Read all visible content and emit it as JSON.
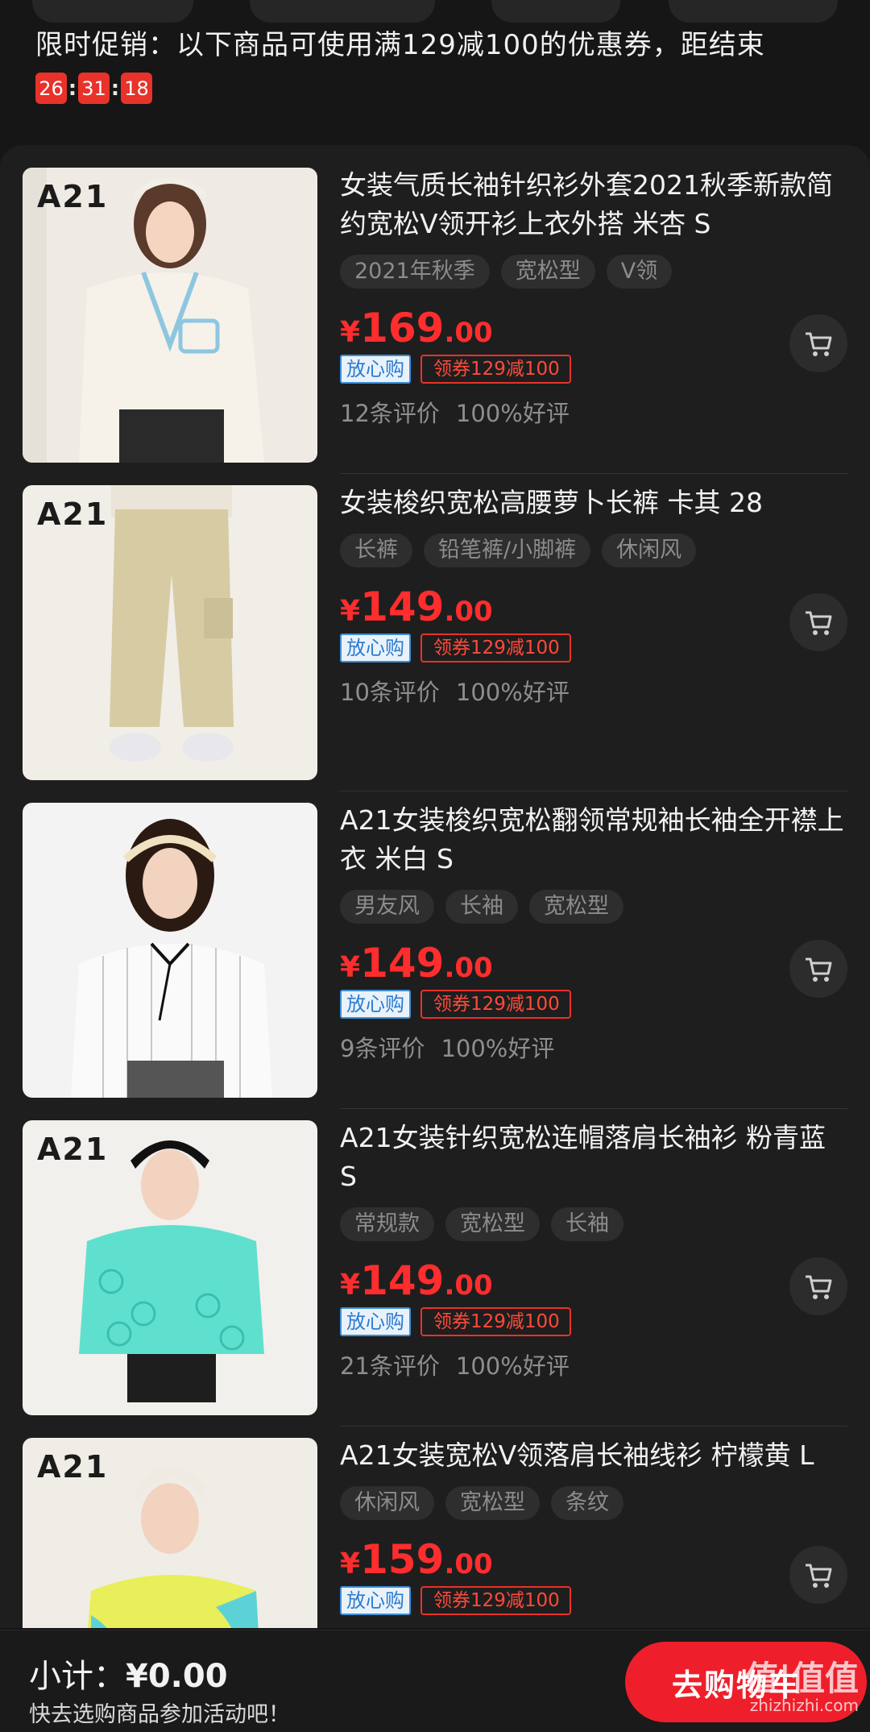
{
  "promo": {
    "text": "限时促销：以下商品可使用满129减100的优惠券，距结束",
    "countdown": {
      "hours": "26",
      "minutes": "31",
      "seconds": "18",
      "sep": ":"
    }
  },
  "products": [
    {
      "title": "女装气质长袖针织衫外套2021秋季新款简约宽松V领开衫上衣外搭 米杏 S",
      "brand_logo": "A21",
      "tags": [
        "2021年秋季",
        "宽松型",
        "V领"
      ],
      "price_currency": "¥",
      "price_int": "169",
      "price_dec": ".00",
      "badge_safe": "放心购",
      "badge_coupon": "领券129减100",
      "review_count": "12条评价",
      "review_rate": "100%好评"
    },
    {
      "title": "女装梭织宽松高腰萝卜长裤 卡其 28",
      "brand_logo": "A21",
      "tags": [
        "长裤",
        "铅笔裤/小脚裤",
        "休闲风"
      ],
      "price_currency": "¥",
      "price_int": "149",
      "price_dec": ".00",
      "badge_safe": "放心购",
      "badge_coupon": "领券129减100",
      "review_count": "10条评价",
      "review_rate": "100%好评"
    },
    {
      "title": "A21女装梭织宽松翻领常规袖长袖全开襟上衣 米白 S",
      "tags": [
        "男友风",
        "长袖",
        "宽松型"
      ],
      "price_currency": "¥",
      "price_int": "149",
      "price_dec": ".00",
      "badge_safe": "放心购",
      "badge_coupon": "领券129减100",
      "review_count": "9条评价",
      "review_rate": "100%好评"
    },
    {
      "title": "A21女装针织宽松连帽落肩长袖衫 粉青蓝 S",
      "brand_logo": "A21",
      "tags": [
        "常规款",
        "宽松型",
        "长袖"
      ],
      "price_currency": "¥",
      "price_int": "149",
      "price_dec": ".00",
      "badge_safe": "放心购",
      "badge_coupon": "领券129减100",
      "review_count": "21条评价",
      "review_rate": "100%好评"
    },
    {
      "title": "A21女装宽松V领落肩长袖线衫 柠檬黄 L",
      "brand_logo": "A21",
      "tags": [
        "休闲风",
        "宽松型",
        "条纹"
      ],
      "price_currency": "¥",
      "price_int": "159",
      "price_dec": ".00",
      "badge_safe": "放心购",
      "badge_coupon": "领券129减100"
    }
  ],
  "footer": {
    "subtotal_label": "小计：",
    "subtotal_value": "¥0.00",
    "hint": "快去选购商品参加活动吧！",
    "go_button": "去购物车"
  },
  "watermark": {
    "main": "值|值值",
    "sub": "zhizhizhi.com"
  },
  "colors": {
    "accent": "#ee1f2a",
    "price": "#ff2d2d",
    "background": "#161616",
    "panel": "#1e1e1e"
  },
  "icons": {
    "cart": "cart-icon"
  }
}
